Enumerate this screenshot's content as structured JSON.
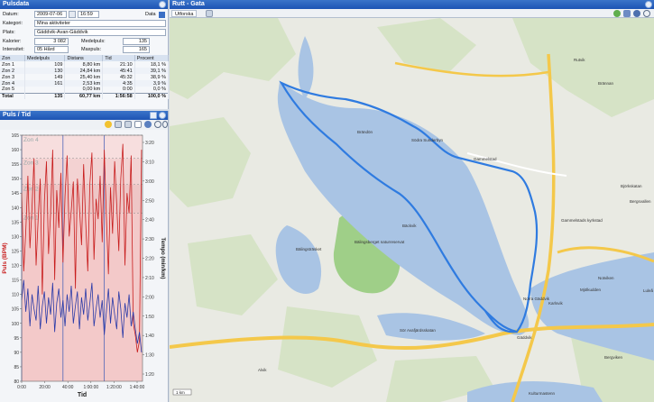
{
  "pulsdata": {
    "title": "Pulsdata",
    "datum_label": "Datum:",
    "datum_value": "2009-07-06",
    "time_value": "16:59",
    "data_button": "Data",
    "kategori_label": "Kategori:",
    "kategori_value": "Mina aktiviteter",
    "plats_label": "Plats:",
    "plats_value": "Gäddvik-Avan-Gäddvik",
    "kalorier_label": "Kalorier:",
    "kalorier_value": "3 082",
    "medelpuls_label": "Medelpuls:",
    "medelpuls_value": "135",
    "intensitet_label": "Intensitet:",
    "intensitet_value": "05 Hård",
    "maxpuls_label": "Maxpuls:",
    "maxpuls_value": "165",
    "table": {
      "headers": [
        "Zon",
        "Medelpuls",
        "Distans",
        "Tid",
        "Procent"
      ],
      "rows": [
        [
          "Zon 1",
          "109",
          "8,80 km",
          "21:10",
          "18,1 %"
        ],
        [
          "Zon 2",
          "130",
          "24,84 km",
          "45:41",
          "39,1 %"
        ],
        [
          "Zon 3",
          "149",
          "25,40 km",
          "45:32",
          "38,9 %"
        ],
        [
          "Zon 4",
          "161",
          "2,53 km",
          "4:35",
          "3,9 %"
        ],
        [
          "Zon 5",
          "",
          "0,00 km",
          "0:00",
          "0,0 %"
        ]
      ],
      "total": [
        "Total",
        "135",
        "60,77 km",
        "1:56:58",
        "100,0 %"
      ]
    }
  },
  "chart_panel": {
    "title": "Puls / Tid"
  },
  "chart_data": {
    "type": "line",
    "xlabel": "Tid",
    "ylabel": "Puls (BPM)",
    "y2label": "Tempo (min/km)",
    "x_ticks": [
      "0:00",
      "20:00",
      "40:00",
      "1:00:00",
      "1:20:00",
      "1:40:00"
    ],
    "x_range_min": [
      0,
      117
    ],
    "y_ticks": [
      80,
      85,
      90,
      95,
      100,
      105,
      110,
      115,
      120,
      125,
      130,
      135,
      140,
      145,
      150,
      155,
      160,
      165
    ],
    "ylim": [
      80,
      165
    ],
    "y2_ticks": [
      "1:20",
      "1:30",
      "1:40",
      "1:50",
      "2:00",
      "2:10",
      "2:20",
      "2:30",
      "2:40",
      "2:50",
      "3:00",
      "3:10",
      "3:20"
    ],
    "zones": [
      {
        "name": "Zon 4",
        "from": 157,
        "to": 165
      },
      {
        "name": "Zon 3",
        "from": 148,
        "to": 157
      },
      {
        "name": "Zon 2",
        "from": 138,
        "to": 148
      },
      {
        "name": "Zon 1",
        "from": 80,
        "to": 138
      }
    ],
    "series": [
      {
        "name": "Puls",
        "color": "#c81e1e",
        "x": [
          0,
          2,
          4,
          6,
          8,
          10,
          12,
          14,
          16,
          18,
          20,
          22,
          24,
          26,
          28,
          30,
          32,
          34,
          36,
          38,
          40,
          42,
          44,
          46,
          48,
          50,
          52,
          54,
          56,
          58,
          60,
          62,
          64,
          66,
          68,
          70,
          72,
          74,
          76,
          78,
          80,
          82,
          84,
          86,
          88,
          90,
          92,
          94,
          96,
          98,
          100,
          102,
          104,
          106,
          108,
          110,
          112,
          114,
          116
        ],
        "values": [
          145,
          118,
          132,
          151,
          126,
          140,
          157,
          120,
          136,
          150,
          110,
          142,
          156,
          124,
          138,
          160,
          115,
          146,
          133,
          152,
          121,
          144,
          158,
          130,
          139,
          149,
          112,
          150,
          140,
          127,
          155,
          135,
          118,
          148,
          159,
          122,
          143,
          136,
          151,
          128,
          160,
          137,
          117,
          147,
          131,
          156,
          141,
          125,
          150,
          162,
          120,
          145,
          138,
          158,
          100,
          96,
          90,
          94,
          160
        ]
      },
      {
        "name": "Tempo",
        "color": "#2a3aa8",
        "x": [
          0,
          2,
          4,
          6,
          8,
          10,
          12,
          14,
          16,
          18,
          20,
          22,
          24,
          26,
          28,
          30,
          32,
          34,
          36,
          38,
          40,
          42,
          44,
          46,
          48,
          50,
          52,
          54,
          56,
          58,
          60,
          62,
          64,
          66,
          68,
          70,
          72,
          74,
          76,
          78,
          80,
          82,
          84,
          86,
          88,
          90,
          92,
          94,
          96,
          98,
          100,
          102,
          104,
          106,
          108,
          110,
          112,
          114,
          116
        ],
        "values": [
          108,
          115,
          104,
          112,
          99,
          110,
          105,
          101,
          113,
          98,
          106,
          111,
          100,
          109,
          103,
          114,
          97,
          107,
          112,
          102,
          108,
          99,
          110,
          104,
          113,
          100,
          106,
          111,
          98,
          109,
          103,
          112,
          101,
          107,
          114,
          99,
          105,
          110,
          102,
          108,
          96,
          104,
          112,
          100,
          109,
          103,
          98,
          111,
          105,
          95,
          107,
          102,
          110,
          99,
          104,
          98,
          93,
          97,
          90
        ]
      }
    ]
  },
  "map": {
    "title": "Rutt - Gata",
    "toolbar_dropdown": "Utforska",
    "scale_label": "1 km",
    "route_color": "#2f7be0",
    "place_names": [
      "Brändön",
      "Södra Sunderbyn",
      "Gammelstad",
      "Bäckvik",
      "Bälingsträsket",
      "Bälingsberget naturreservat",
      "Norra Gäddvik",
      "Gäddvik",
      "Sör Avafjärdsskatan",
      "Alvik",
      "Karlsvik",
      "Rutvik",
      "Brännan",
      "Notviken",
      "Luleå",
      "Bergviken",
      "Björkskatan",
      "Kulturmastenn",
      "Gammelstads kyrkstad",
      "Mjölkudden",
      "Bergsvallen"
    ]
  }
}
